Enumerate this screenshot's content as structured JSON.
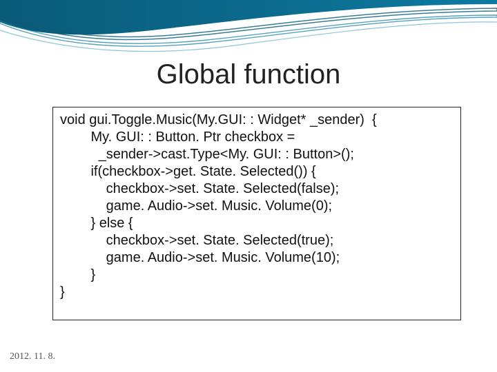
{
  "title": "Global function",
  "code": {
    "l0": "void gui.Toggle.Music(My.GUI: : Widget* _sender)  {",
    "l1": "        My. GUI: : Button. Ptr checkbox =",
    "l2": "          _sender->cast.Type<My. GUI: : Button>();",
    "l3": "        if(checkbox->get. State. Selected()) {",
    "l4": "            checkbox->set. State. Selected(false);",
    "l5": "            game. Audio->set. Music. Volume(0);",
    "l6": "        } else {",
    "l7": "            checkbox->set. State. Selected(true);",
    "l8": "            game. Audio->set. Music. Volume(10);",
    "l9": "        }",
    "l10": "}"
  },
  "date": "2012. 11. 8."
}
